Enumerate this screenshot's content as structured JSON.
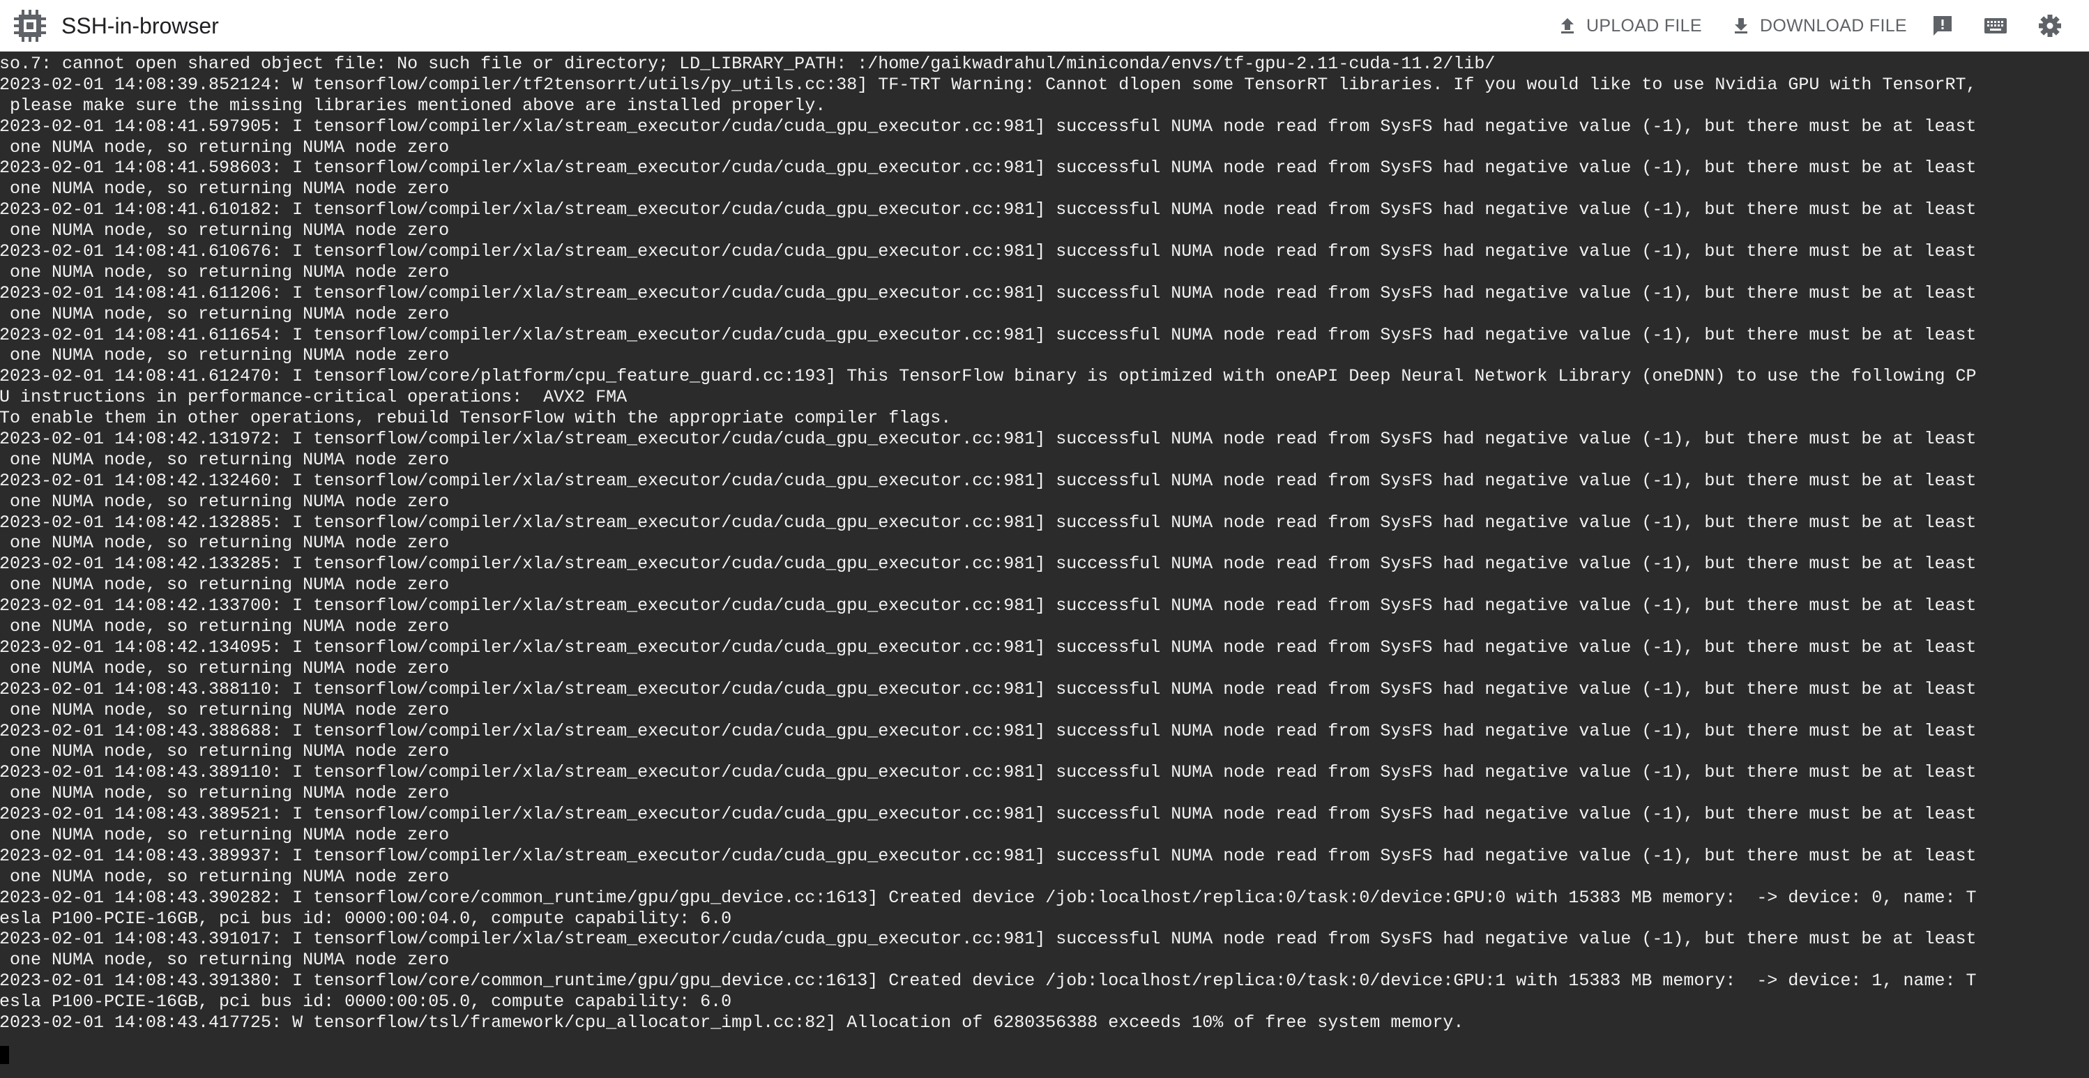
{
  "header": {
    "title": "SSH-in-browser",
    "upload_label": "UPLOAD FILE",
    "download_label": "DOWNLOAD FILE",
    "icons": [
      "chip-icon",
      "upload-icon",
      "download-icon",
      "feedback-icon",
      "keyboard-icon",
      "gear-icon"
    ]
  },
  "terminal": {
    "lines": [
      "so.7: cannot open shared object file: No such file or directory; LD_LIBRARY_PATH: :/home/gaikwadrahul/miniconda/envs/tf-gpu-2.11-cuda-11.2/lib/",
      "2023-02-01 14:08:39.852124: W tensorflow/compiler/tf2tensorrt/utils/py_utils.cc:38] TF-TRT Warning: Cannot dlopen some TensorRT libraries. If you would like to use Nvidia GPU with TensorRT,",
      " please make sure the missing libraries mentioned above are installed properly.",
      "2023-02-01 14:08:41.597905: I tensorflow/compiler/xla/stream_executor/cuda/cuda_gpu_executor.cc:981] successful NUMA node read from SysFS had negative value (-1), but there must be at least",
      " one NUMA node, so returning NUMA node zero",
      "2023-02-01 14:08:41.598603: I tensorflow/compiler/xla/stream_executor/cuda/cuda_gpu_executor.cc:981] successful NUMA node read from SysFS had negative value (-1), but there must be at least",
      " one NUMA node, so returning NUMA node zero",
      "2023-02-01 14:08:41.610182: I tensorflow/compiler/xla/stream_executor/cuda/cuda_gpu_executor.cc:981] successful NUMA node read from SysFS had negative value (-1), but there must be at least",
      " one NUMA node, so returning NUMA node zero",
      "2023-02-01 14:08:41.610676: I tensorflow/compiler/xla/stream_executor/cuda/cuda_gpu_executor.cc:981] successful NUMA node read from SysFS had negative value (-1), but there must be at least",
      " one NUMA node, so returning NUMA node zero",
      "2023-02-01 14:08:41.611206: I tensorflow/compiler/xla/stream_executor/cuda/cuda_gpu_executor.cc:981] successful NUMA node read from SysFS had negative value (-1), but there must be at least",
      " one NUMA node, so returning NUMA node zero",
      "2023-02-01 14:08:41.611654: I tensorflow/compiler/xla/stream_executor/cuda/cuda_gpu_executor.cc:981] successful NUMA node read from SysFS had negative value (-1), but there must be at least",
      " one NUMA node, so returning NUMA node zero",
      "2023-02-01 14:08:41.612470: I tensorflow/core/platform/cpu_feature_guard.cc:193] This TensorFlow binary is optimized with oneAPI Deep Neural Network Library (oneDNN) to use the following CP",
      "U instructions in performance-critical operations:  AVX2 FMA",
      "To enable them in other operations, rebuild TensorFlow with the appropriate compiler flags.",
      "2023-02-01 14:08:42.131972: I tensorflow/compiler/xla/stream_executor/cuda/cuda_gpu_executor.cc:981] successful NUMA node read from SysFS had negative value (-1), but there must be at least",
      " one NUMA node, so returning NUMA node zero",
      "2023-02-01 14:08:42.132460: I tensorflow/compiler/xla/stream_executor/cuda/cuda_gpu_executor.cc:981] successful NUMA node read from SysFS had negative value (-1), but there must be at least",
      " one NUMA node, so returning NUMA node zero",
      "2023-02-01 14:08:42.132885: I tensorflow/compiler/xla/stream_executor/cuda/cuda_gpu_executor.cc:981] successful NUMA node read from SysFS had negative value (-1), but there must be at least",
      " one NUMA node, so returning NUMA node zero",
      "2023-02-01 14:08:42.133285: I tensorflow/compiler/xla/stream_executor/cuda/cuda_gpu_executor.cc:981] successful NUMA node read from SysFS had negative value (-1), but there must be at least",
      " one NUMA node, so returning NUMA node zero",
      "2023-02-01 14:08:42.133700: I tensorflow/compiler/xla/stream_executor/cuda/cuda_gpu_executor.cc:981] successful NUMA node read from SysFS had negative value (-1), but there must be at least",
      " one NUMA node, so returning NUMA node zero",
      "2023-02-01 14:08:42.134095: I tensorflow/compiler/xla/stream_executor/cuda/cuda_gpu_executor.cc:981] successful NUMA node read from SysFS had negative value (-1), but there must be at least",
      " one NUMA node, so returning NUMA node zero",
      "2023-02-01 14:08:43.388110: I tensorflow/compiler/xla/stream_executor/cuda/cuda_gpu_executor.cc:981] successful NUMA node read from SysFS had negative value (-1), but there must be at least",
      " one NUMA node, so returning NUMA node zero",
      "2023-02-01 14:08:43.388688: I tensorflow/compiler/xla/stream_executor/cuda/cuda_gpu_executor.cc:981] successful NUMA node read from SysFS had negative value (-1), but there must be at least",
      " one NUMA node, so returning NUMA node zero",
      "2023-02-01 14:08:43.389110: I tensorflow/compiler/xla/stream_executor/cuda/cuda_gpu_executor.cc:981] successful NUMA node read from SysFS had negative value (-1), but there must be at least",
      " one NUMA node, so returning NUMA node zero",
      "2023-02-01 14:08:43.389521: I tensorflow/compiler/xla/stream_executor/cuda/cuda_gpu_executor.cc:981] successful NUMA node read from SysFS had negative value (-1), but there must be at least",
      " one NUMA node, so returning NUMA node zero",
      "2023-02-01 14:08:43.389937: I tensorflow/compiler/xla/stream_executor/cuda/cuda_gpu_executor.cc:981] successful NUMA node read from SysFS had negative value (-1), but there must be at least",
      " one NUMA node, so returning NUMA node zero",
      "2023-02-01 14:08:43.390282: I tensorflow/core/common_runtime/gpu/gpu_device.cc:1613] Created device /job:localhost/replica:0/task:0/device:GPU:0 with 15383 MB memory:  -> device: 0, name: T",
      "esla P100-PCIE-16GB, pci bus id: 0000:00:04.0, compute capability: 6.0",
      "2023-02-01 14:08:43.391017: I tensorflow/compiler/xla/stream_executor/cuda/cuda_gpu_executor.cc:981] successful NUMA node read from SysFS had negative value (-1), but there must be at least",
      " one NUMA node, so returning NUMA node zero",
      "2023-02-01 14:08:43.391380: I tensorflow/core/common_runtime/gpu/gpu_device.cc:1613] Created device /job:localhost/replica:0/task:0/device:GPU:1 with 15383 MB memory:  -> device: 1, name: T",
      "esla P100-PCIE-16GB, pci bus id: 0000:00:05.0, compute capability: 6.0",
      "2023-02-01 14:08:43.417725: W tensorflow/tsl/framework/cpu_allocator_impl.cc:82] Allocation of 6280356388 exceeds 10% of free system memory."
    ]
  },
  "colors": {
    "terminal_bg": "#2b2b2b",
    "terminal_fg": "#f2f2f2",
    "header_bg": "#ffffff",
    "header_icon": "#5f6368"
  }
}
